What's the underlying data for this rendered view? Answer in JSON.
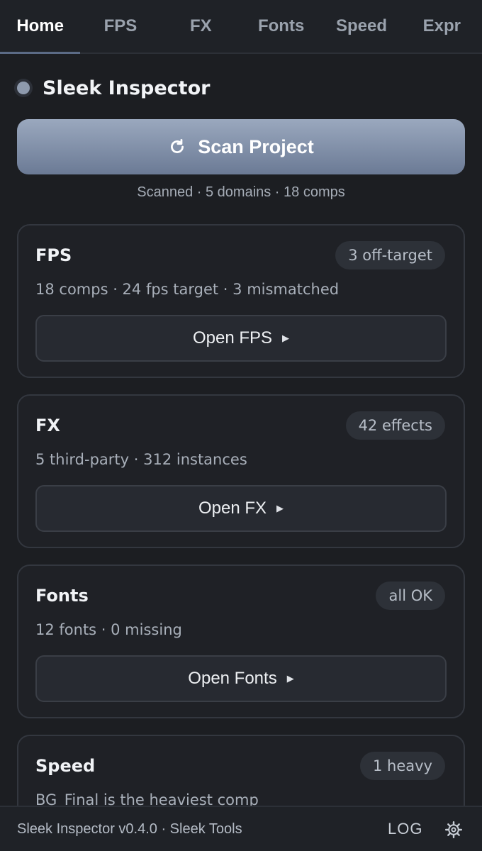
{
  "tabs": [
    {
      "label": "Home",
      "active": true
    },
    {
      "label": "FPS",
      "active": false
    },
    {
      "label": "FX",
      "active": false
    },
    {
      "label": "Fonts",
      "active": false
    },
    {
      "label": "Speed",
      "active": false
    },
    {
      "label": "Expr",
      "active": false
    }
  ],
  "header": {
    "title": "Sleek Inspector",
    "status_icon": "status-dot"
  },
  "scan": {
    "label": "Scan Project",
    "icon": "refresh-icon",
    "status": "Scanned · 5 domains · 18 comps"
  },
  "cards": [
    {
      "title": "FPS",
      "badge": "3 off-target",
      "desc": "18 comps · 24 fps target · 3 mismatched",
      "button": "Open FPS"
    },
    {
      "title": "FX",
      "badge": "42 effects",
      "desc": "5 third-party · 312 instances",
      "button": "Open FX"
    },
    {
      "title": "Fonts",
      "badge": "all OK",
      "desc": "12 fonts · 0 missing",
      "button": "Open Fonts"
    },
    {
      "title": "Speed",
      "badge": "1 heavy",
      "desc": "BG_Final is the heaviest comp",
      "button": ""
    }
  ],
  "footer": {
    "text": "Sleek Inspector v0.4.0 · Sleek Tools",
    "log_label": "LOG",
    "settings_icon": "gear-icon"
  },
  "colors": {
    "background": "#1c1e22",
    "accent": "#7f8ea8"
  }
}
